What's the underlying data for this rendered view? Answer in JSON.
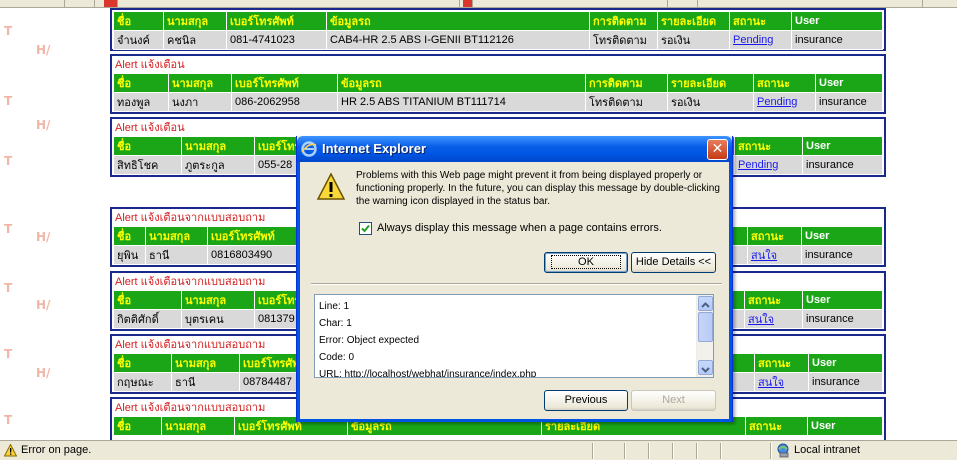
{
  "app": {
    "dialog_title": "Internet Explorer"
  },
  "dialog": {
    "message": "Problems with this Web page might prevent it from being displayed properly or functioning properly. In the future, you can display this message by double-clicking the warning icon displayed in the status bar.",
    "checkbox_label": "Always display this message when a page contains errors.",
    "checkbox_checked": true,
    "ok_label": "OK",
    "hide_details_label": "Hide Details <<",
    "details": {
      "line": "Line:  1",
      "char": "Char: 1",
      "error": "Error: Object expected",
      "code": "Code: 0",
      "url": "URL:  http://localhost/webhat/insurance/index.php"
    },
    "previous_label": "Previous",
    "next_label": "Next",
    "close_glyph": "✕"
  },
  "statusbar": {
    "text": "Error on page.",
    "zone": "Local intranet"
  },
  "sidebar_letters": {
    "t": "T",
    "h": "H/"
  },
  "headers": {
    "name": "ชื่อ",
    "surname": "นามสกุล",
    "phone": "เบอร์โทรศัพท์",
    "car": "ข้อมูลรถ",
    "follow": "การติดตาม",
    "detail": "รายละเอียด",
    "status": "สถานะ",
    "user": "User"
  },
  "alerts": [
    {
      "title": "",
      "row": {
        "name": "จำนงค์",
        "surname": "คชนิล",
        "phone": "081-4741023",
        "car": "CAB4-HR 2.5 ABS I-GENII BT112126",
        "follow": "โทรติดตาม",
        "detail": "รอเงิน",
        "status": "Pending",
        "user": "insurance"
      }
    },
    {
      "title": "Alert แจ้งเตือน",
      "row": {
        "name": "ทองพูล",
        "surname": "นงภา",
        "phone": "086-2062958",
        "car": "HR 2.5 ABS TITANIUM BT111714",
        "follow": "โทรติดตาม",
        "detail": "รอเงิน",
        "status": "Pending",
        "user": "insurance"
      }
    },
    {
      "title": "Alert แจ้งเตือน",
      "row": {
        "name": "สิทธิโชค",
        "surname": "ภูตระกูล",
        "phone": "055-28",
        "status": "Pending",
        "user": "insurance"
      }
    },
    {
      "title": "Alert แจ้งเตือนจากแบบสอบถาม",
      "row": {
        "name": "ยุพิน",
        "surname": "ธานี",
        "phone": "0816803490",
        "status": "สนใจ",
        "user": "insurance"
      }
    },
    {
      "title": "Alert แจ้งเตือนจากแบบสอบถาม",
      "row": {
        "name": "กิตติศักดิ์",
        "surname": "บุตรเคน",
        "phone": "081379",
        "status": "สนใจ",
        "user": "insurance"
      }
    },
    {
      "title": "Alert แจ้งเตือนจากแบบสอบถาม",
      "row": {
        "name": "กฤษณะ",
        "surname": "ธานี",
        "phone": "08784487",
        "status": "สนใจ",
        "user": "insurance"
      }
    },
    {
      "title": "Alert แจ้งเตือนจากแบบสอบถาม",
      "headers_only": true,
      "detail_header": "รายละเอียด"
    }
  ]
}
